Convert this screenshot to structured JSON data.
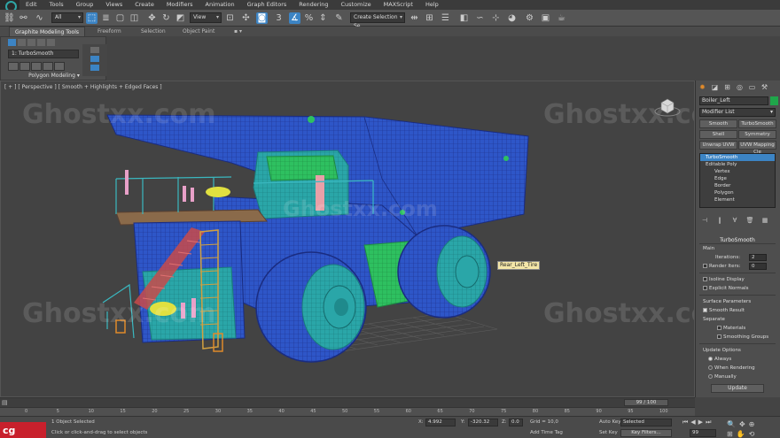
{
  "menu": [
    "Edit",
    "Tools",
    "Group",
    "Views",
    "Create",
    "Modifiers",
    "Animation",
    "Graph Editors",
    "Rendering",
    "Customize",
    "MAXScript",
    "Help"
  ],
  "toolbar": {
    "selection_filter": "All",
    "reference_coord": "View",
    "named_selection": "Create Selection Se"
  },
  "ribbon": {
    "tabs": [
      "Graphite Modeling Tools",
      "Freeform",
      "Selection",
      "Object Paint"
    ],
    "modifier_field": "1: TurboSmooth",
    "panel_label": "Polygon Modeling ▾"
  },
  "viewport": {
    "label": "[ + ] [ Perspective ] [ Smooth + Highlights + Edged Faces ]",
    "tooltip": "Rear_Left_Tire",
    "watermark": "Ghostxx.com"
  },
  "command_panel": {
    "object_name": "Boiler_Left",
    "modifier_list": "Modifier List",
    "quick_buttons": [
      "Smooth",
      "TurboSmooth",
      "Shell",
      "Symmetry",
      "Unwrap UVW",
      "UVW Mapping Cle"
    ],
    "stack": [
      {
        "label": "TurboSmooth",
        "selected": true,
        "sub": false
      },
      {
        "label": "Editable Poly",
        "selected": false,
        "sub": false
      },
      {
        "label": "Vertex",
        "selected": false,
        "sub": true
      },
      {
        "label": "Edge",
        "selected": false,
        "sub": true
      },
      {
        "label": "Border",
        "selected": false,
        "sub": true
      },
      {
        "label": "Polygon",
        "selected": false,
        "sub": true
      },
      {
        "label": "Element",
        "selected": false,
        "sub": true
      }
    ],
    "rollout_title": "TurboSmooth",
    "main_label": "Main",
    "iterations_label": "Iterations:",
    "iterations_value": "2",
    "render_iters_label": "Render Iters:",
    "render_iters_value": "0",
    "isoline_label": "Isoline Display",
    "explicit_normals_label": "Explicit Normals",
    "surface_params_label": "Surface Parameters",
    "smooth_result_label": "Smooth Result",
    "separate_label": "Separate",
    "materials_label": "Materials",
    "smoothing_groups_label": "Smoothing Groups",
    "update_options_label": "Update Options",
    "always_label": "Always",
    "when_rendering_label": "When Rendering",
    "manually_label": "Manually",
    "update_button": "Update"
  },
  "timeline": {
    "frame": "99 / 100",
    "ticks": [
      "0",
      "5",
      "10",
      "15",
      "20",
      "25",
      "30",
      "35",
      "40",
      "45",
      "50",
      "55",
      "60",
      "65",
      "70",
      "75",
      "80",
      "85",
      "90",
      "95",
      "100"
    ]
  },
  "status": {
    "logo_text": "cg tuts+",
    "selection_info": "1 Object Selected",
    "prompt": "Click or click-and-drag to select objects",
    "x_label": "X:",
    "x_value": "4.992",
    "y_label": "Y:",
    "y_value": "-320.32",
    "z_label": "Z:",
    "z_value": "0.0",
    "grid_label": "Grid = 10,0",
    "add_time_tag": "Add Time Tag",
    "auto_key": "Auto Key",
    "auto_key_value": "Selected",
    "set_key": "Set Key",
    "key_filters": "Key Filters...",
    "frame_field": "99"
  },
  "colors": {
    "mesh_blue": "#2e56c8",
    "mesh_green": "#2ec060",
    "mesh_teal": "#2aa6a8",
    "accent_blue": "#3c84c4",
    "object_color": "#1fa64a",
    "brand_red": "#c8202c"
  }
}
